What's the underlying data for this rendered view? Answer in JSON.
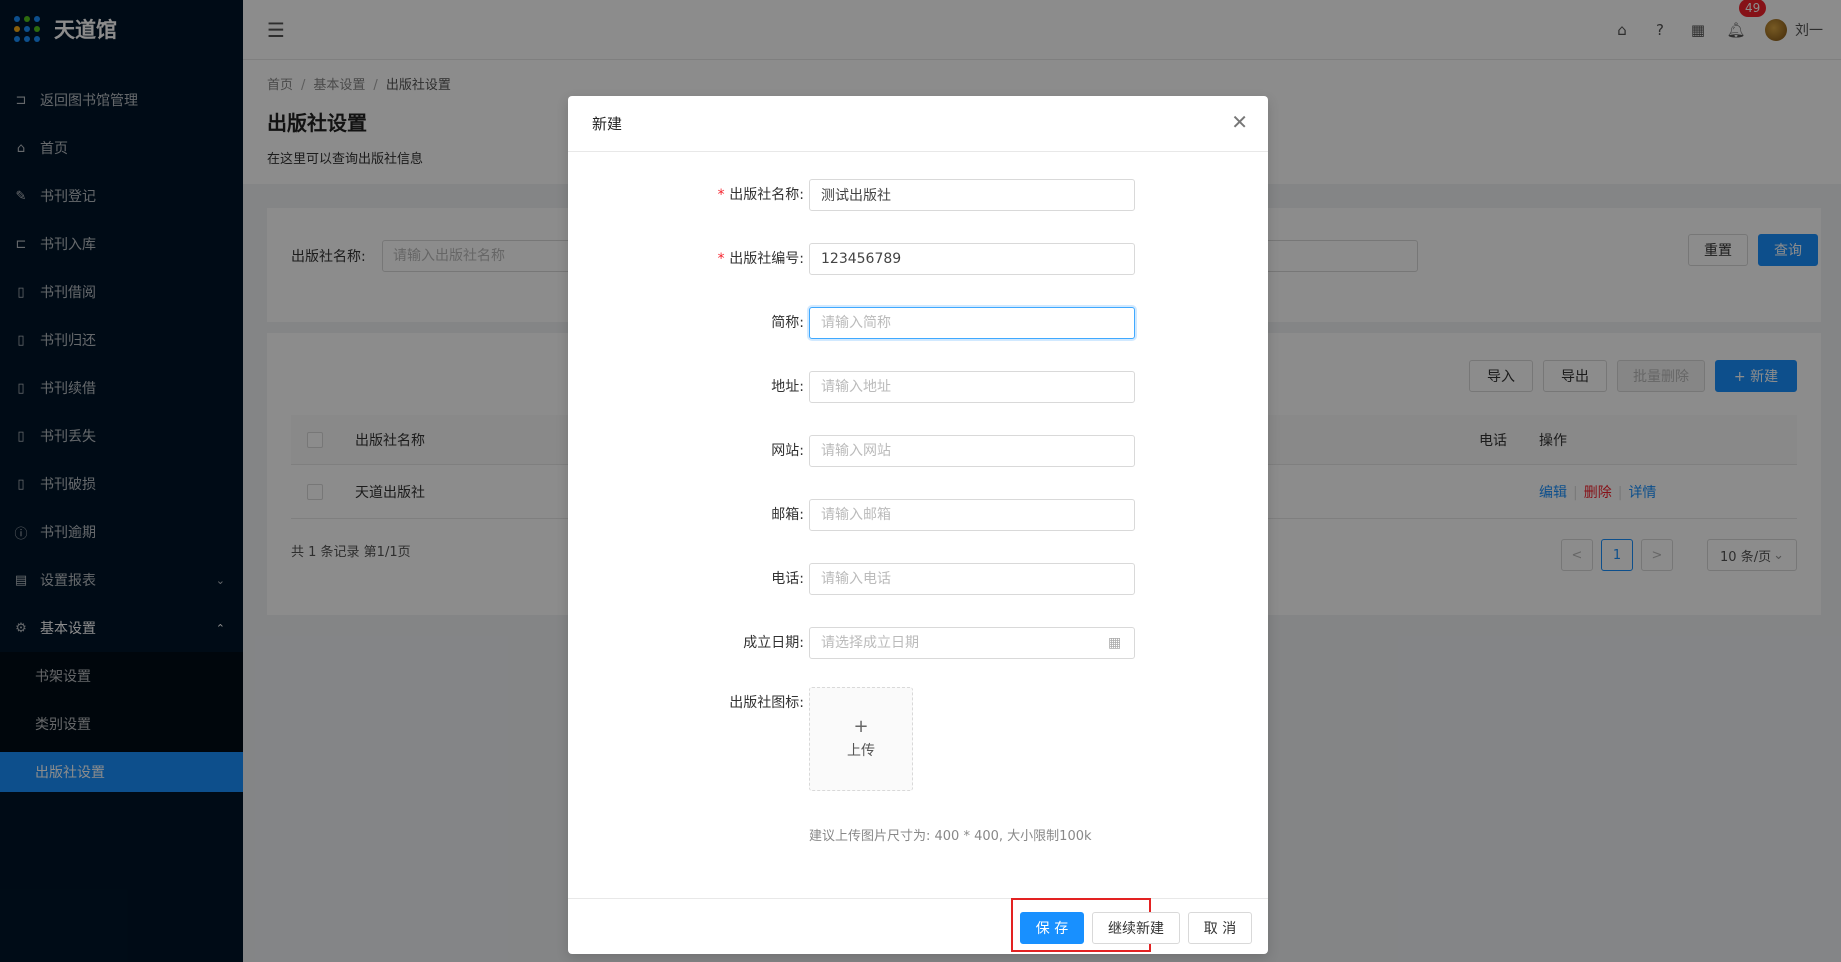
{
  "app": {
    "name": "天道馆"
  },
  "sidebar": {
    "items": [
      {
        "label": "返回图书馆管理",
        "icon": "return-icon",
        "glyph": "⊐"
      },
      {
        "label": "首页",
        "icon": "home-icon",
        "glyph": "⌂"
      },
      {
        "label": "书刊登记",
        "icon": "edit-icon",
        "glyph": "✎"
      },
      {
        "label": "书刊入库",
        "icon": "import-icon",
        "glyph": "⊏"
      },
      {
        "label": "书刊借阅",
        "icon": "book-icon",
        "glyph": "▯"
      },
      {
        "label": "书刊归还",
        "icon": "book-icon",
        "glyph": "▯"
      },
      {
        "label": "书刊续借",
        "icon": "book-icon",
        "glyph": "▯"
      },
      {
        "label": "书刊丢失",
        "icon": "book-icon",
        "glyph": "▯"
      },
      {
        "label": "书刊破损",
        "icon": "book-icon",
        "glyph": "▯"
      },
      {
        "label": "书刊逾期",
        "icon": "info-icon",
        "glyph": "ⓘ"
      },
      {
        "label": "设置报表",
        "icon": "report-icon",
        "glyph": "▤"
      },
      {
        "label": "基本设置",
        "icon": "gear-icon",
        "glyph": "⚙"
      }
    ],
    "submenu": [
      {
        "label": "书架设置"
      },
      {
        "label": "类别设置"
      },
      {
        "label": "出版社设置"
      }
    ]
  },
  "header": {
    "notification_count": "49",
    "username": "刘一"
  },
  "page": {
    "breadcrumb": [
      "首页",
      "基本设置",
      "出版社设置"
    ],
    "title": "出版社设置",
    "description": "在这里可以查询出版社信息"
  },
  "search": {
    "label": "出版社名称:",
    "placeholder": "请输入出版社名称",
    "reset_label": "重置",
    "query_label": "查询"
  },
  "toolbar": {
    "import_label": "导入",
    "export_label": "导出",
    "batch_delete_label": "批量删除",
    "new_label": "+ 新建"
  },
  "table": {
    "columns": {
      "name": "出版社名称",
      "phone": "电话",
      "ops": "操作"
    },
    "rows": [
      {
        "name": "天道出版社",
        "phone": "",
        "edit": "编辑",
        "delete": "删除",
        "detail": "详情"
      }
    ],
    "total_text": "共 1 条记录 第1/1页"
  },
  "pagination": {
    "prev": "<",
    "current": "1",
    "next": ">",
    "page_size": "10 条/页"
  },
  "modal": {
    "title": "新建",
    "fields": {
      "name": {
        "label": "出版社名称:",
        "value": "测试出版社",
        "required": true
      },
      "code": {
        "label": "出版社编号:",
        "value": "123456789",
        "required": true
      },
      "short": {
        "label": "简称:",
        "placeholder": "请输入简称"
      },
      "address": {
        "label": "地址:",
        "placeholder": "请输入地址"
      },
      "website": {
        "label": "网站:",
        "placeholder": "请输入网站"
      },
      "email": {
        "label": "邮箱:",
        "placeholder": "请输入邮箱"
      },
      "phone": {
        "label": "电话:",
        "placeholder": "请输入电话"
      },
      "date": {
        "label": "成立日期:",
        "placeholder": "请选择成立日期"
      },
      "logo": {
        "label": "出版社图标:",
        "upload_text": "上传"
      }
    },
    "hint": "建议上传图片尺寸为: 400 * 400, 大小限制100k",
    "save_label": "保 存",
    "continue_label": "继续新建",
    "cancel_label": "取 消"
  },
  "colors": {
    "primary": "#1890ff",
    "sidebar": "#001529",
    "danger": "#f5222d",
    "highlight": "#e32222"
  }
}
